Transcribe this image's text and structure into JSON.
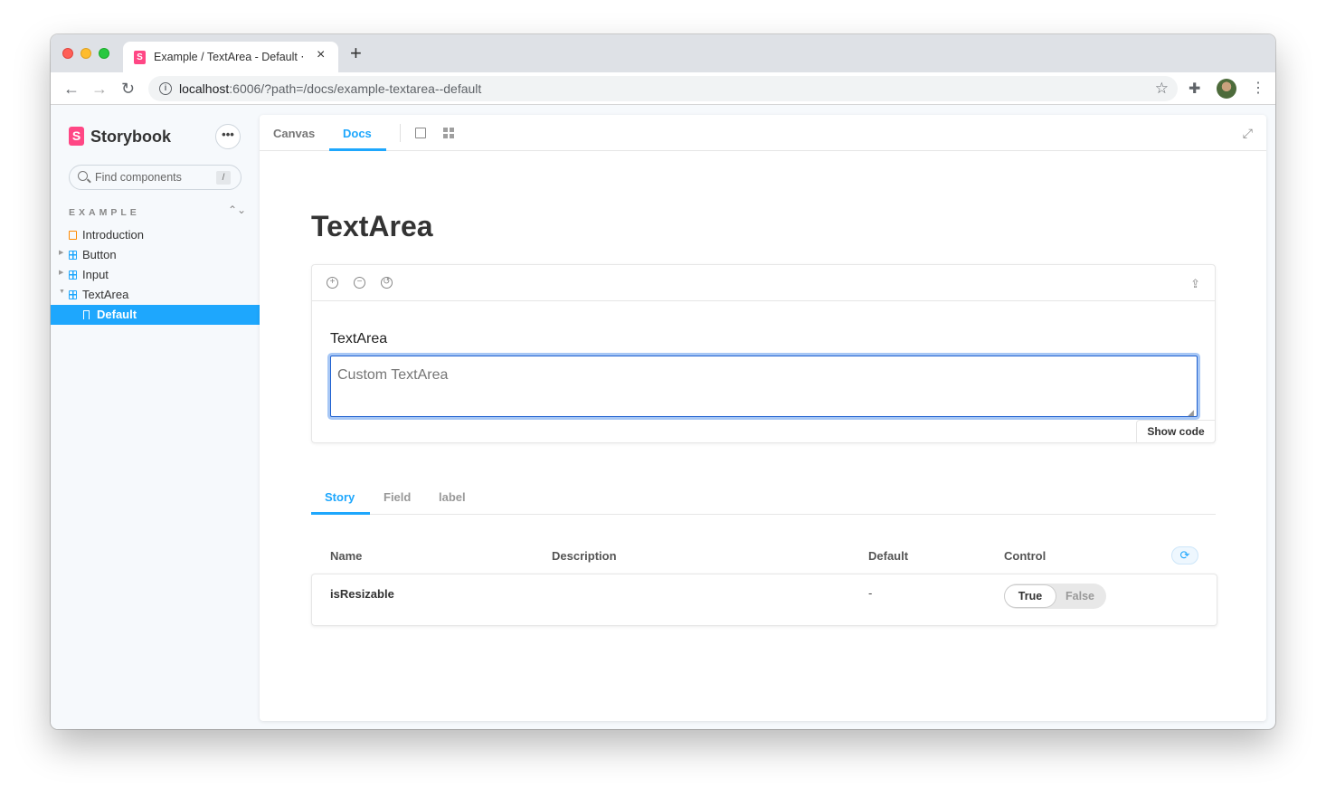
{
  "browser": {
    "tab_title": "Example / TextArea - Default ⋅ Storybook",
    "url_host": "localhost",
    "url_rest": ":6006/?path=/docs/example-textarea--default"
  },
  "sidebar": {
    "brand": "Storybook",
    "search_placeholder": "Find components",
    "search_shortcut": "/",
    "section": "EXAMPLE",
    "items": [
      {
        "label": "Introduction",
        "type": "doc"
      },
      {
        "label": "Button",
        "type": "component"
      },
      {
        "label": "Input",
        "type": "component"
      },
      {
        "label": "TextArea",
        "type": "component",
        "expanded": true
      },
      {
        "label": "Default",
        "type": "story",
        "selected": true
      }
    ]
  },
  "main": {
    "tabs": [
      {
        "label": "Canvas"
      },
      {
        "label": "Docs",
        "active": true
      }
    ],
    "title": "TextArea",
    "preview": {
      "field_label": "TextArea",
      "textarea_placeholder": "Custom TextArea",
      "show_code": "Show code"
    },
    "args_tabs": [
      {
        "label": "Story",
        "active": true
      },
      {
        "label": "Field"
      },
      {
        "label": "label"
      }
    ],
    "table": {
      "headers": {
        "name": "Name",
        "description": "Description",
        "default": "Default",
        "control": "Control"
      },
      "rows": [
        {
          "name": "isResizable",
          "description": "",
          "default": "-",
          "control": {
            "true_label": "True",
            "false_label": "False",
            "value": true
          }
        }
      ]
    }
  },
  "colors": {
    "accent": "#1ea7fd",
    "brand": "#ff4785"
  }
}
